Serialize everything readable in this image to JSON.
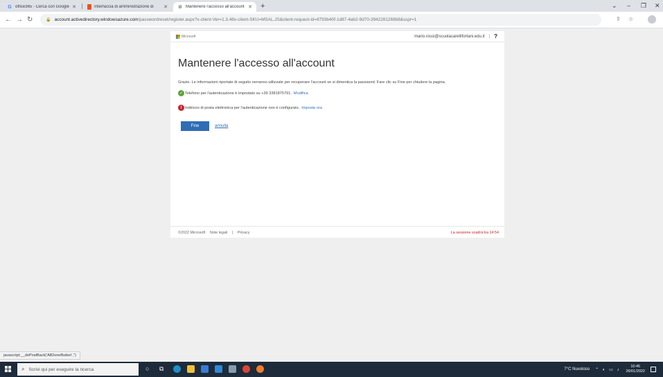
{
  "browser": {
    "tabs": [
      {
        "title": "office365 - Cerca con Google",
        "icon": "google-icon",
        "active": false
      },
      {
        "title": "Interfaccia di amministrazione di",
        "icon": "office-icon",
        "active": false
      },
      {
        "title": "Mantenere l'accesso all'account",
        "icon": "microsoft-account-icon",
        "active": true
      }
    ],
    "new_tab_symbol": "+",
    "url_host": "account.activedirectory.windowsazure.com",
    "url_path": "/passwordreset/register.aspx?x-client-Ver=1.3.48x-client-SKU=MSAL.JS&client-request-id=8793b40f-1d87-4ab2-9d70-3942281269b8&sspr=1"
  },
  "page": {
    "brand": "Microsoft",
    "user_email": "mario.rossi@scuolacarellifortani.edu.it",
    "user_divider": "|",
    "help_symbol": "?",
    "title": "Mantenere l'accesso all'account",
    "intro": "Grazie. Le informazioni riportate di seguito verranno utilizzate per recuperare l'account se si dimentica la password. Fare clic su Fine per chiudere la pagina.",
    "phone_status": {
      "text": "Telefono per l'autenticazione è impostato su +39 3381875791.",
      "link": "Modifica",
      "state": "ok",
      "color": "#5aa33b"
    },
    "email_status": {
      "text": "Indirizzo di posta elettronica per l'autenticazione non è configurato.",
      "link": "Imposta ora",
      "state": "error",
      "color": "#c4262e"
    },
    "finish_label": "Fine",
    "cancel_label": "annulla",
    "footer": {
      "copyright": "©2022 Microsoft",
      "legal": "Note legali",
      "divider": "|",
      "privacy": "Privacy",
      "session": "La sessione scadrà tra 14:54"
    }
  },
  "status_bar_url": "javascript:__doPostBack('AllDoneButton','')",
  "taskbar": {
    "search_placeholder": "Scrivi qui per eseguire la ricerca",
    "weather": "7°C Nuvoloso",
    "time": "10:45",
    "date": "26/01/2022"
  },
  "colors": {
    "accent": "#2f6db4",
    "success": "#5aa33b",
    "error": "#c4262e"
  }
}
